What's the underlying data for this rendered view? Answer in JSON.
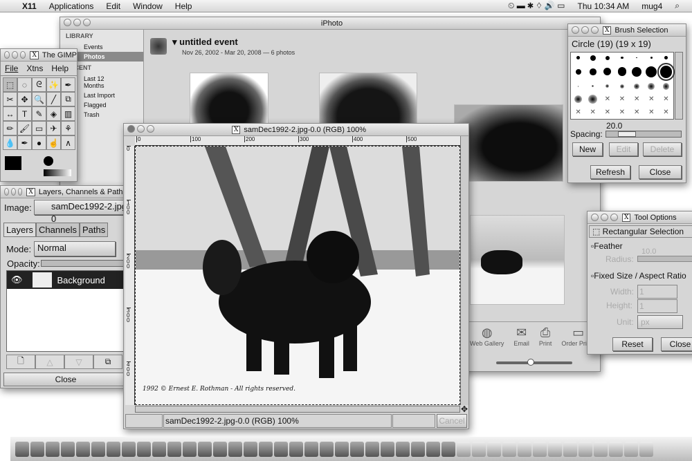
{
  "menubar": {
    "app": "X11",
    "items": [
      "Applications",
      "Edit",
      "Window",
      "Help"
    ],
    "clock": "Thu 10:34 AM",
    "user": "mug4"
  },
  "iphoto": {
    "title": "iPhoto",
    "sidebar": {
      "library_heading": "LIBRARY",
      "library": [
        "Events",
        "Photos"
      ],
      "recent_heading": "RECENT",
      "recent": [
        "Last 12 Months",
        "Last Import",
        "Flagged",
        "Trash"
      ],
      "selected": "Photos"
    },
    "event_title": "untitled event",
    "event_sub": "Nov 26, 2002 - Mar 20, 2008 — 6 photos",
    "toolbar": [
      "Web Gallery",
      "Email",
      "Print",
      "Order Prints"
    ],
    "zoom_level": 0.45
  },
  "toolbox": {
    "title": "The GIMP",
    "menu": [
      "File",
      "Xtns",
      "Help"
    ],
    "tools": [
      "rect-select",
      "ellipse-select",
      "lasso",
      "fuzzy-select",
      "bezier",
      "scissors",
      "move",
      "magnify",
      "crop",
      "transform",
      "flip",
      "text",
      "color-picker",
      "bucket-fill",
      "gradient",
      "pencil",
      "paintbrush",
      "eraser",
      "airbrush",
      "clone",
      "convolve",
      "ink",
      "dodge",
      "smudge",
      "measure"
    ],
    "tool_glyphs": [
      "⬚",
      "◌",
      "ᘓ",
      "✨",
      "✒",
      "✂",
      "✥",
      "🔍",
      "╱",
      "⧉",
      "↔",
      "T",
      "✎",
      "◈",
      "▥",
      "✏",
      "🖌",
      "▭",
      "✈",
      "⚘",
      "💧",
      "✒",
      "●",
      "☝",
      "∧"
    ]
  },
  "layers": {
    "title": "Layers, Channels & Paths",
    "image_label": "Image:",
    "image_value": "samDec1992-2.jpg-0",
    "tabs": [
      "Layers",
      "Channels",
      "Paths"
    ],
    "active_tab": "Layers",
    "mode_label": "Mode:",
    "mode_value": "Normal",
    "opacity_label": "Opacity:",
    "layer_name": "Background",
    "close": "Close"
  },
  "image_window": {
    "title": "samDec1992-2.jpg-0.0 (RGB) 100%",
    "ruler_h": [
      "0",
      "100",
      "200",
      "300",
      "400",
      "500"
    ],
    "ruler_v": [
      "0",
      "100",
      "200",
      "300",
      "400"
    ],
    "caption": "1992 © Ernest E. Rothman - All rights reserved.",
    "status": "samDec1992-2.jpg-0.0 (RGB) 100%",
    "cancel": "Cancel"
  },
  "brush": {
    "title": "Brush Selection",
    "current": "Circle (19)  (19 x 19)",
    "spacing_label": "Spacing:",
    "spacing_value": "20.0",
    "spacing_fraction": 0.2,
    "buttons": [
      "New",
      "Edit",
      "Delete"
    ],
    "refresh": "Refresh",
    "close": "Close"
  },
  "tool_options": {
    "title": "Tool Options",
    "tool": "Rectangular Selection",
    "feather": "Feather",
    "radius_label": "Radius:",
    "radius_value": "10.0",
    "fixed": "Fixed Size / Aspect Ratio",
    "width_label": "Width:",
    "width_value": "1",
    "height_label": "Height:",
    "height_value": "1",
    "unit_label": "Unit:",
    "unit_value": "px",
    "reset": "Reset",
    "close": "Close"
  }
}
